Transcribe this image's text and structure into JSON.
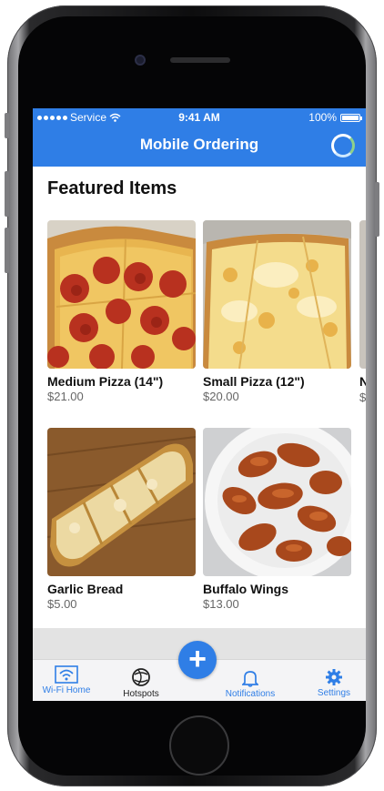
{
  "status_bar": {
    "carrier": "Service",
    "time": "9:41 AM",
    "battery": "100%"
  },
  "header": {
    "title": "Mobile Ordering"
  },
  "featured": {
    "title": "Featured Items",
    "items": [
      {
        "name": "Medium Pizza (14\")",
        "price": "$21.00"
      },
      {
        "name": "Small Pizza (12\")",
        "price": "$20.00"
      },
      {
        "name": "Garlic Bread",
        "price": "$5.00"
      },
      {
        "name": "Buffalo Wings",
        "price": "$13.00"
      }
    ],
    "peek_name": "N",
    "peek_price": "$"
  },
  "tabbar": {
    "items": [
      {
        "label": "Wi-Fi Home",
        "icon": "wifi-home-icon"
      },
      {
        "label": "Hotspots",
        "icon": "globe-icon"
      },
      {
        "label": "Notifications",
        "icon": "bell-icon"
      },
      {
        "label": "Settings",
        "icon": "gear-icon"
      }
    ],
    "fab": "+"
  },
  "colors": {
    "brand": "#2f7ee6",
    "tab_bg": "#f4f4f6"
  }
}
